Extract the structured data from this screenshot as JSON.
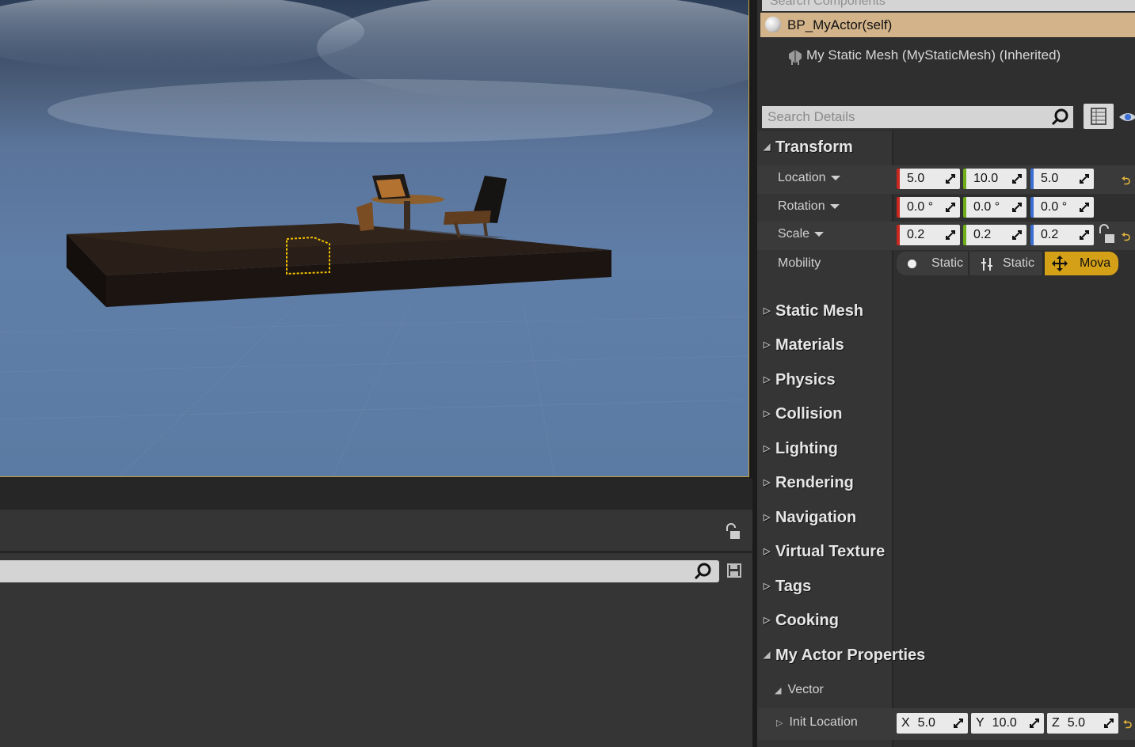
{
  "viewport": {
    "selection_color": "#f0c000"
  },
  "components": {
    "search_placeholder": "Search Components",
    "root_label": "BP_MyActor(self)",
    "child_label": "My Static Mesh (MyStaticMesh) (Inherited)"
  },
  "details": {
    "search_placeholder": "Search Details",
    "transform": {
      "title": "Transform",
      "location": {
        "label": "Location",
        "x": "5.0",
        "y": "10.0",
        "z": "5.0"
      },
      "rotation": {
        "label": "Rotation",
        "x": "0.0 °",
        "y": "0.0 °",
        "z": "0.0 °"
      },
      "scale": {
        "label": "Scale",
        "x": "0.2",
        "y": "0.2",
        "z": "0.2"
      },
      "mobility": {
        "label": "Mobility",
        "opt1": "Static",
        "opt2": "Static",
        "opt3": "Mova",
        "selected": "Mova"
      }
    },
    "categories": [
      "Static Mesh",
      "Materials",
      "Physics",
      "Collision",
      "Lighting",
      "Rendering",
      "Navigation",
      "Virtual Texture",
      "Tags",
      "Cooking"
    ],
    "my_actor": {
      "title": "My Actor Properties",
      "vector_label": "Vector",
      "init_location_label": "Init Location",
      "x_axis": "X",
      "x": "5.0",
      "y_axis": "Y",
      "y": "10.0",
      "z_axis": "Z",
      "z": "5.0"
    }
  },
  "colors": {
    "x_axis": "#c8281f",
    "y_axis": "#6fae18",
    "z_axis": "#3b6fd4",
    "selected": "#d4a017",
    "header_highlight": "#d3b48a"
  }
}
